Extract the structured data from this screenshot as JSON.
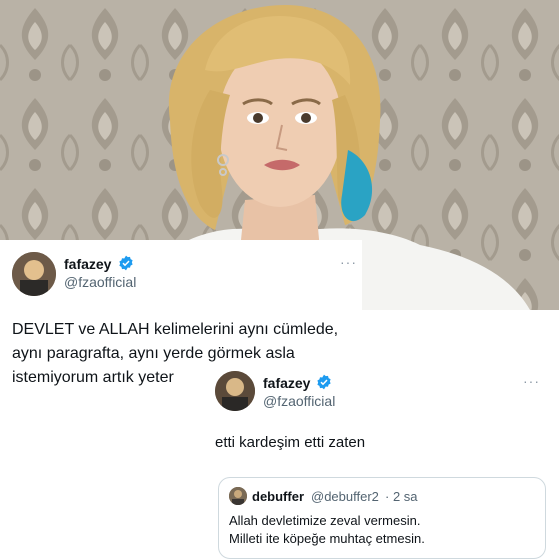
{
  "tweet_main": {
    "display_name": "fafazey",
    "handle": "@fzaofficial",
    "more_label": "···",
    "text": "DEVLET ve ALLAH kelimelerini aynı cümlede,\naynı paragrafta, aynı yerde görmek asla\nistemiyorum artık yeter"
  },
  "tweet_reply": {
    "display_name": "fafazey",
    "handle": "@fzaofficial",
    "more_label": "···",
    "text": "etti kardeşim etti zaten"
  },
  "quoted_tweet": {
    "display_name": "debuffer",
    "handle": "@debuffer2",
    "time": "· 2 sa",
    "text": "Allah devletimize zeval vermesin.\nMilleti ite köpeğe muhtaç etmesin."
  },
  "colors": {
    "verified": "#1d9bf0",
    "text": "#0f1419",
    "muted": "#536471",
    "wallpaper": "#b7b0a4",
    "hair": "#d8b46a",
    "blue_hair": "#2aa3c4"
  },
  "icons": [
    "verified-badge-icon",
    "more-options-icon"
  ]
}
